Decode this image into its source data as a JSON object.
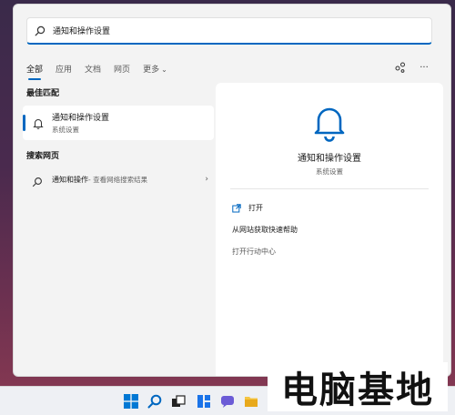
{
  "search": {
    "query": "通知和操作设置",
    "icon": "search-icon"
  },
  "tabs": [
    {
      "label": "全部",
      "active": true
    },
    {
      "label": "应用",
      "active": false
    },
    {
      "label": "文档",
      "active": false
    },
    {
      "label": "网页",
      "active": false
    },
    {
      "label": "更多",
      "active": false
    }
  ],
  "header_actions": {
    "share_icon": "share-icon",
    "more_label": "···"
  },
  "best_match": {
    "section_title": "最佳匹配",
    "item_title": "通知和操作设置",
    "item_subtitle": "系统设置"
  },
  "web_search": {
    "section_title": "搜索网页",
    "query_text": "通知和操作",
    "query_suffix": " - 查看网络搜索结果",
    "arrow": "›"
  },
  "detail": {
    "title": "通知和操作设置",
    "subtitle": "系统设置",
    "actions": [
      {
        "label": "打开"
      },
      {
        "label": "从网站获取快速帮助"
      },
      {
        "label": "打开行动中心"
      }
    ]
  },
  "watermark": {
    "text": "电脑基地"
  },
  "colors": {
    "accent": "#0067c0",
    "panel_bg": "#f3f3f3"
  }
}
